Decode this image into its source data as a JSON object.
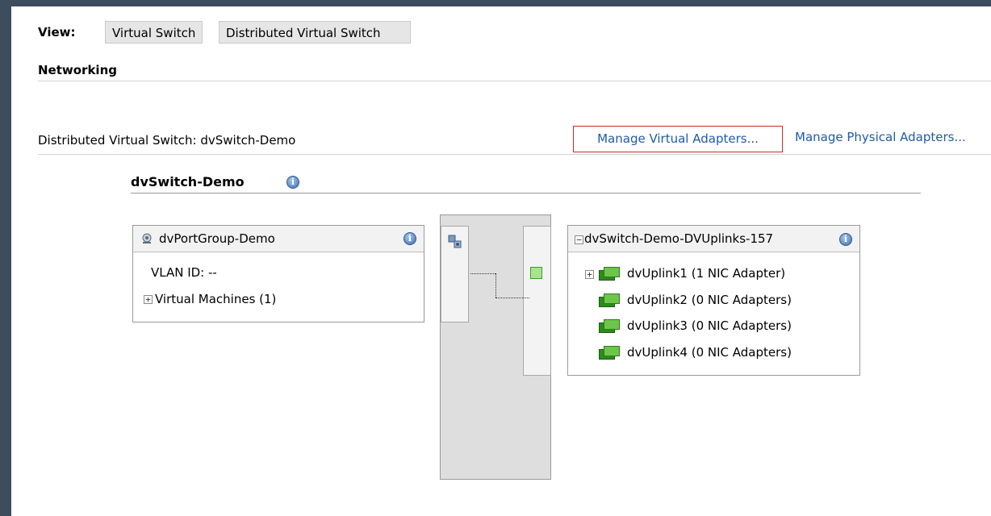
{
  "view": {
    "label": "View:",
    "tabs": [
      {
        "label": "Virtual Switch"
      },
      {
        "label": "Distributed Virtual Switch"
      }
    ]
  },
  "section_title": "Networking",
  "dvs_line": "Distributed Virtual Switch: dvSwitch-Demo",
  "actions": {
    "manage_virtual": "Manage Virtual Adapters...",
    "manage_physical": "Manage Physical Adapters..."
  },
  "switch": {
    "name": "dvSwitch-Demo",
    "info_glyph": "i"
  },
  "port_group": {
    "name": "dvPortGroup-Demo",
    "vlan": "VLAN ID: --",
    "vm_expander": "+",
    "virtual_machines": "Virtual Machines (1)",
    "icon": "portgroup-icon",
    "info_glyph": "i"
  },
  "uplinks": {
    "expander": "−",
    "name": "dvSwitch-Demo-DVUplinks-157",
    "info_glyph": "i",
    "items": [
      {
        "expander": "+",
        "label": "dvUplink1 (1 NIC Adapter)"
      },
      {
        "expander": "",
        "label": "dvUplink2 (0 NIC Adapters)"
      },
      {
        "expander": "",
        "label": "dvUplink3 (0 NIC Adapters)"
      },
      {
        "expander": "",
        "label": "dvUplink4 (0 NIC Adapters)"
      }
    ]
  },
  "colors": {
    "link": "#1f5ba8",
    "highlight_border": "#d42828",
    "nic_green": "#6cc64a",
    "background": "#3d4d5e"
  }
}
